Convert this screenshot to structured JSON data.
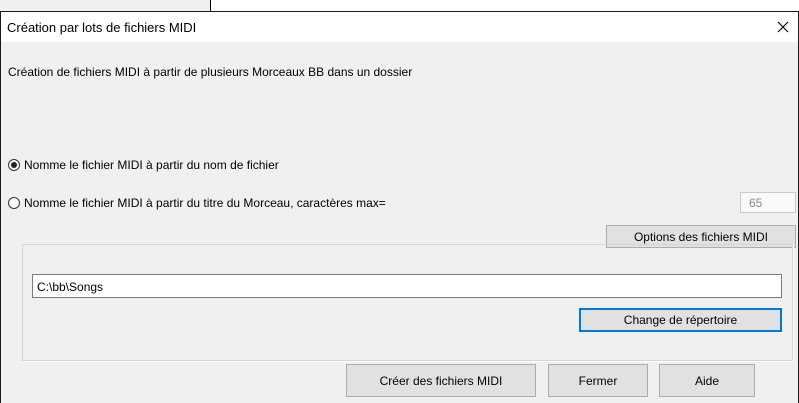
{
  "window": {
    "title": "Création par lots de fichiers MIDI"
  },
  "description": "Création de fichiers MIDI à partir de plusieurs Morceaux BB dans un dossier",
  "naming": {
    "option_filename": "Nomme le fichier MIDI à partir du nom de fichier",
    "option_title": "Nomme le fichier MIDI à partir du titre du Morceau,   caractères max=",
    "selected": "filename",
    "max_chars": "65"
  },
  "buttons": {
    "midi_options": "Options des fichiers MIDI",
    "change_folder": "Change de répertoire",
    "create": "Créer des fichiers MIDI",
    "close": "Fermer",
    "help": "Aide"
  },
  "folder": {
    "path": "C:\\bb\\Songs"
  },
  "icons": {
    "close": "close-icon"
  }
}
